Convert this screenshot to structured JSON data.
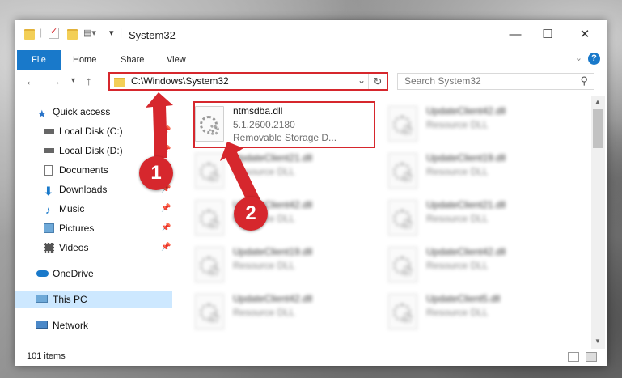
{
  "window": {
    "title": "System32",
    "controls": {
      "minimize": "—",
      "maximize": "☐",
      "close": "✕"
    }
  },
  "ribbon": {
    "tabs": [
      "File",
      "Home",
      "Share",
      "View"
    ],
    "help": "?"
  },
  "address": {
    "path": "C:\\Windows\\System32",
    "search_placeholder": "Search System32"
  },
  "nav": {
    "items": [
      {
        "label": "Quick access",
        "icon": "star-icon",
        "pinned": false
      },
      {
        "label": "Local Disk (C:)",
        "icon": "drive-icon",
        "pinned": true
      },
      {
        "label": "Local Disk (D:)",
        "icon": "drive-icon",
        "pinned": true
      },
      {
        "label": "Documents",
        "icon": "documents-icon",
        "pinned": true
      },
      {
        "label": "Downloads",
        "icon": "downloads-icon",
        "pinned": true
      },
      {
        "label": "Music",
        "icon": "music-icon",
        "pinned": true
      },
      {
        "label": "Pictures",
        "icon": "pictures-icon",
        "pinned": true
      },
      {
        "label": "Videos",
        "icon": "videos-icon",
        "pinned": true
      },
      {
        "label": "OneDrive",
        "icon": "cloud-icon",
        "pinned": false
      },
      {
        "label": "This PC",
        "icon": "computer-icon",
        "pinned": false,
        "selected": true
      },
      {
        "label": "Network",
        "icon": "network-icon",
        "pinned": false
      }
    ]
  },
  "files": [
    {
      "name": "ntmsdba.dll",
      "line2": "5.1.2600.2180",
      "line3": "Removable Storage D..."
    },
    {
      "name": "UpdateClient42.dll",
      "line2": "Resource DLL"
    },
    {
      "name": "UpdateClient21.dll",
      "line2": "Resource DLL"
    },
    {
      "name": "UpdateClient19.dll",
      "line2": "Resource DLL"
    },
    {
      "name": "UpdateClient42.dll",
      "line2": "Resource DLL"
    },
    {
      "name": "UpdateClient21.dll",
      "line2": "Resource DLL"
    },
    {
      "name": "UpdateClient19.dll",
      "line2": "Resource DLL"
    },
    {
      "name": "UpdateClient42.dll",
      "line2": "Resource DLL"
    },
    {
      "name": "UpdateClient42.dll",
      "line2": "Resource DLL"
    },
    {
      "name": "UpdateClient5.dll",
      "line2": "Resource DLL"
    }
  ],
  "status": {
    "count": "101 items"
  },
  "callouts": [
    "1",
    "2"
  ],
  "colors": {
    "accent": "#1979ca",
    "highlight": "#d6272d",
    "selected": "#cde8ff"
  }
}
